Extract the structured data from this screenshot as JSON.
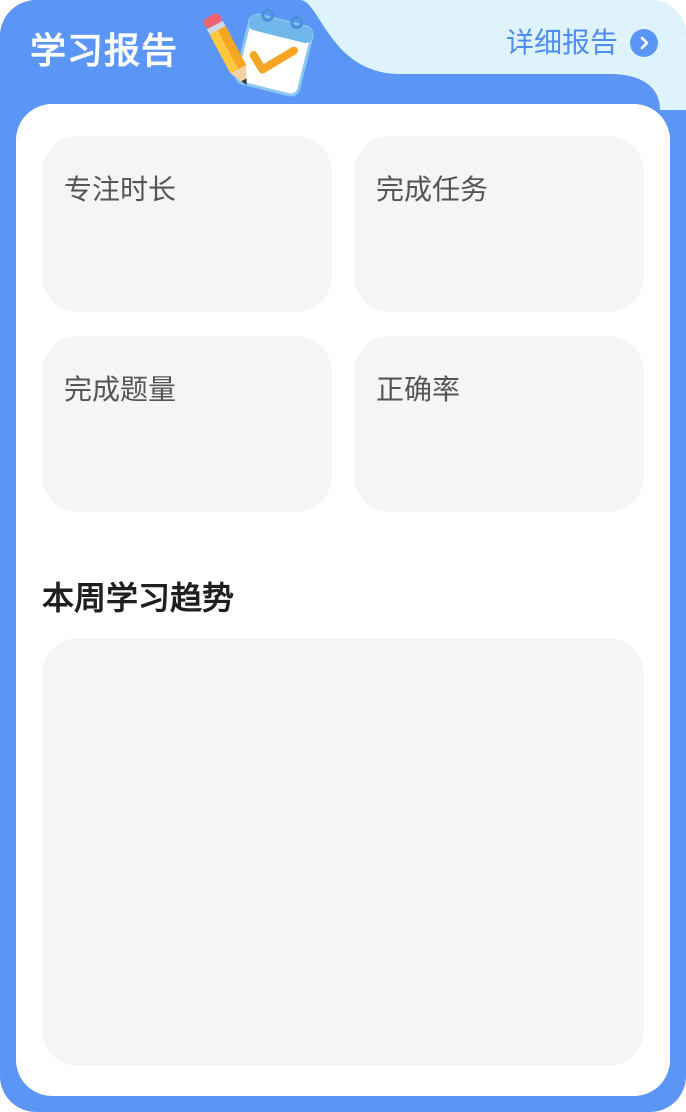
{
  "header": {
    "title": "学习报告",
    "detail_link_label": "详细报告",
    "detail_link_icon": "chevron-right-icon",
    "illustration_icon": "pencil-calendar-checkmark-icon"
  },
  "stats": [
    {
      "label": "专注时长"
    },
    {
      "label": "完成任务"
    },
    {
      "label": "完成题量"
    },
    {
      "label": "正确率"
    }
  ],
  "trend": {
    "title": "本周学习趋势"
  },
  "colors": {
    "card_background": "#5b95f5",
    "header_highlight": "#dff3fd",
    "link_text": "#4f8cf0",
    "tile_background": "#f5f5f5",
    "panel_background": "#ffffff"
  }
}
